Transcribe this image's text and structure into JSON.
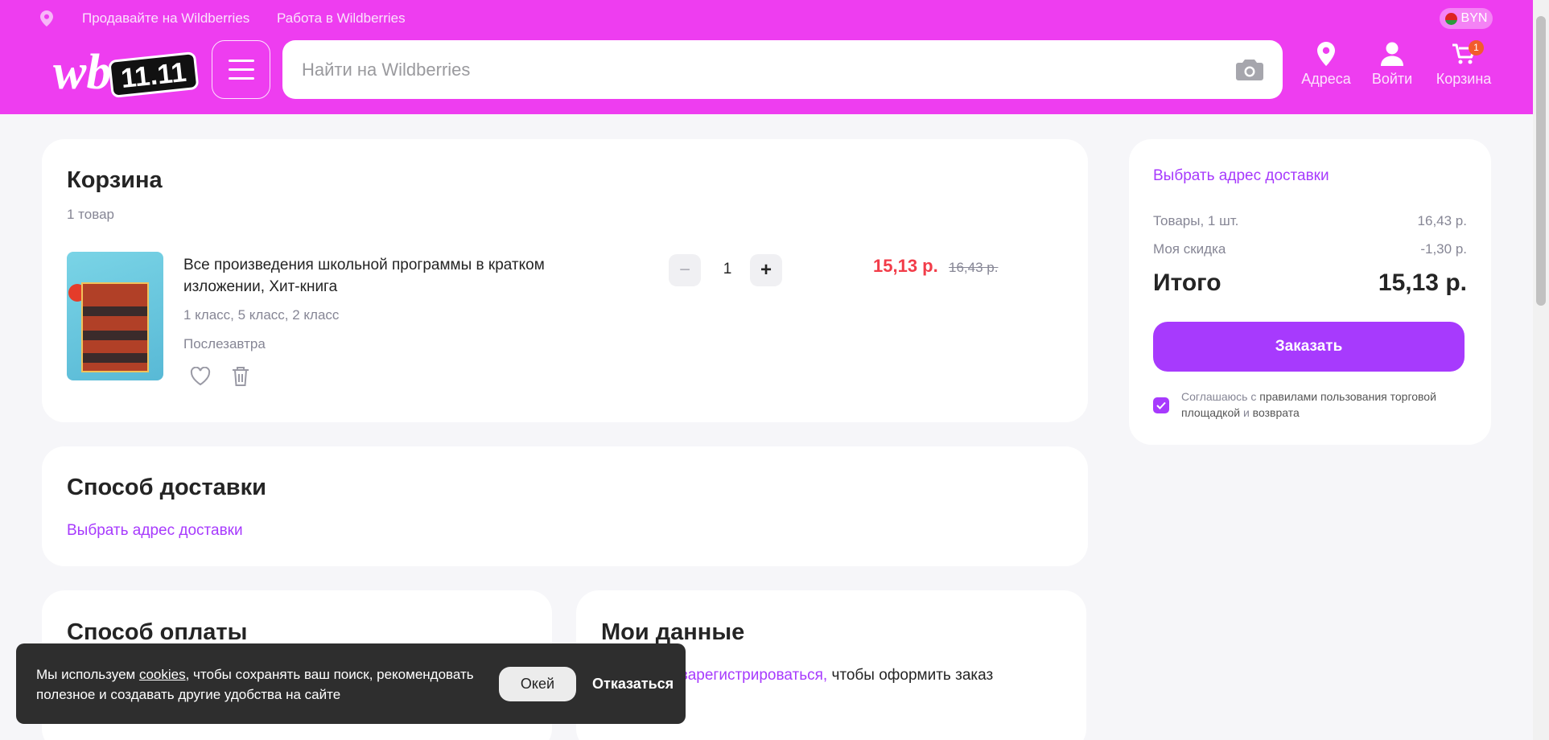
{
  "topbar": {
    "sell_link": "Продавайте на Wildberries",
    "work_link": "Работа в Wildberries",
    "currency": "BYN"
  },
  "logo": {
    "brand": "wb",
    "promo": "11.11"
  },
  "search": {
    "placeholder": "Найти на Wildberries",
    "value": ""
  },
  "nav": {
    "addresses": "Адреса",
    "login": "Войти",
    "cart": "Корзина",
    "cart_count": "1"
  },
  "cart": {
    "title": "Корзина",
    "count": "1 товар",
    "item": {
      "name_line1": "Все произведения школьной программы в кратком",
      "name_line2": "изложении, Хит-книга",
      "attrs": "1 класс, 5 класс, 2 класс",
      "delivery": "Послезавтра",
      "qty": "1",
      "minus": "−",
      "plus": "+",
      "price": "15,13 р.",
      "old_price": "16,43 р."
    }
  },
  "delivery": {
    "title": "Способ доставки",
    "choose": "Выбрать адрес доставки"
  },
  "payment": {
    "title": "Способ оплаты"
  },
  "mydata": {
    "title": "Мои данные",
    "register_link": "зарегистрироваться,",
    "register_rest": "чтобы оформить заказ"
  },
  "summary": {
    "choose_address": "Выбрать адрес доставки",
    "goods_label": "Товары, 1 шт.",
    "goods_value": "16,43 р.",
    "discount_label": "Моя скидка",
    "discount_value": "-1,30 р.",
    "total_label": "Итого",
    "total_value": "15,13 р.",
    "order_button": "Заказать",
    "agree_prefix": "Соглашаюсь с",
    "agree_rules": "правилами пользования торговой",
    "agree_rules2": "площадкой",
    "agree_and": "и",
    "agree_return": "возврата"
  },
  "cookie": {
    "text_a": "Мы используем",
    "text_link": "cookies",
    "text_b": ", чтобы сохранять ваш поиск, рекомендовать",
    "text_c": "полезное и создавать другие удобства на сайте",
    "ok": "Окей",
    "decline": "Отказаться"
  },
  "colors": {
    "header": "#ee3df0",
    "accent": "#a73afd",
    "price": "#f23c49"
  }
}
